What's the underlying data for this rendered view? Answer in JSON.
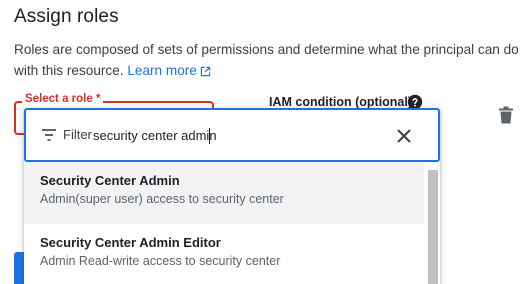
{
  "panel": {
    "title": "Assign roles",
    "description": "Roles are composed of sets of permissions and determine what the principal can do with this resource.",
    "learn_more": "Learn more"
  },
  "role_field": {
    "label": "Select a role *"
  },
  "iam_condition": {
    "label": "IAM condition (optional)"
  },
  "filter": {
    "prefix": "Filter",
    "value": "security center admin"
  },
  "options": [
    {
      "title": "Security Center Admin",
      "description": "Admin(super user) access to security center"
    },
    {
      "title": "Security Center Admin Editor",
      "description": "Admin Read-write access to security center"
    }
  ],
  "colors": {
    "accent": "#1a73e8",
    "error": "#d93025",
    "highlight": "#f1f3f4"
  },
  "icons": [
    "external-link-icon",
    "help-icon",
    "delete-icon",
    "filter-icon",
    "close-icon"
  ]
}
